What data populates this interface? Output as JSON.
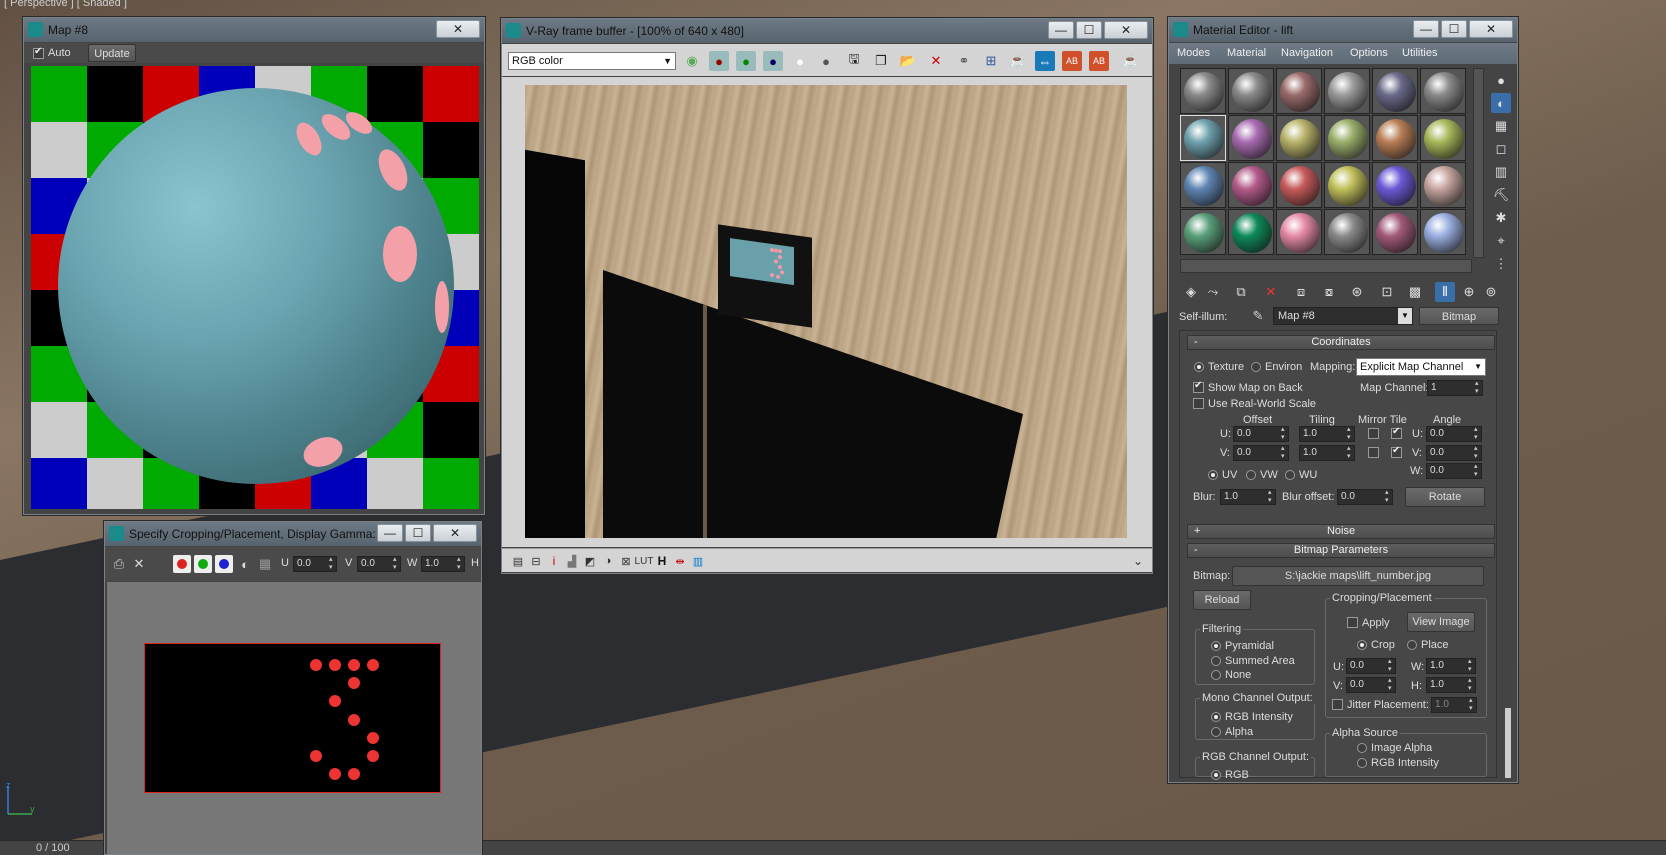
{
  "viewport": {
    "label": "[ Perspective ] [ Shaded ]"
  },
  "status_bar": {
    "progress": "0 / 100"
  },
  "map8": {
    "title": "Map #8",
    "auto_label": "Auto",
    "update_label": "Update",
    "checker_colors": [
      "#00aa00",
      "#0000bb",
      "#000000",
      "#cccccc",
      "#cc0000"
    ]
  },
  "crop": {
    "title": "Specify Cropping/Placement, Display Gamma: 2....",
    "u_label": "U",
    "u_value": "0.0",
    "v_label": "V",
    "v_value": "0.0",
    "w_label": "W",
    "w_value": "1.0",
    "h_label": "H"
  },
  "vray": {
    "title": "V-Ray frame buffer - [100% of 640 x 480]",
    "channel": "RGB color",
    "lut_label": "LUT",
    "h_label": "H"
  },
  "mat": {
    "title": "Material Editor - lift",
    "menu": [
      "Modes",
      "Material",
      "Navigation",
      "Options",
      "Utilities"
    ],
    "sphere_colors": [
      "#8a8a8a",
      "#8a8a8a",
      "#9a6a6a",
      "#9a9a9a",
      "#6a6a8a",
      "#8a8a8a",
      "#6fa2ad",
      "#a86bb0",
      "#b9b36a",
      "#9aae6a",
      "#b87e55",
      "#a7b85a",
      "#5f86b3",
      "#b45a8a",
      "#c75a5a",
      "#c0c05a",
      "#6a5ad6",
      "#c7a5a0",
      "#5aa07a",
      "#0d8a5a",
      "#e58aa5",
      "#8a8a8a",
      "#a25a7a",
      "#9aaee0"
    ],
    "selfillum_label": "Self-illum:",
    "selfillum_value": "Map #8",
    "bitmap_btn": "Bitmap",
    "coords": {
      "header": "Coordinates",
      "texture": "Texture",
      "environ": "Environ",
      "mapping_label": "Mapping:",
      "mapping_value": "Explicit Map Channel",
      "show_map": "Show Map on Back",
      "map_channel_label": "Map Channel:",
      "map_channel_value": "1",
      "real_world": "Use Real-World Scale",
      "offset": "Offset",
      "tiling": "Tiling",
      "mirror_tile": "Mirror Tile",
      "angle": "Angle",
      "u": "U:",
      "v": "V:",
      "w": "W:",
      "u_offset": "0.0",
      "v_offset": "0.0",
      "u_tiling": "1.0",
      "v_tiling": "1.0",
      "u_angle": "0.0",
      "v_angle": "0.0",
      "w_angle": "0.0",
      "uv": "UV",
      "vw": "VW",
      "wu": "WU",
      "blur_label": "Blur:",
      "blur_value": "1.0",
      "blur_offset_label": "Blur offset:",
      "blur_offset_value": "0.0",
      "rotate": "Rotate"
    },
    "noise_header": "Noise",
    "bitmap_params": {
      "header": "Bitmap Parameters",
      "bitmap_label": "Bitmap:",
      "bitmap_path": "S:\\jackie maps\\lift_number.jpg",
      "reload": "Reload",
      "crop_group": "Cropping/Placement",
      "apply": "Apply",
      "view_image": "View Image",
      "crop": "Crop",
      "place": "Place",
      "u": "U:",
      "v": "V:",
      "w": "W:",
      "h": "H:",
      "u_value": "0.0",
      "v_value": "0.0",
      "w_value": "1.0",
      "h_value": "1.0",
      "jitter": "Jitter Placement:",
      "jitter_value": "1.0",
      "filtering": "Filtering",
      "pyramidal": "Pyramidal",
      "summed": "Summed Area",
      "none": "None",
      "mono": "Mono Channel Output:",
      "rgb_intensity": "RGB Intensity",
      "alpha": "Alpha",
      "rgb_channel": "RGB Channel Output:",
      "rgb": "RGB",
      "alpha_source": "Alpha Source",
      "image_alpha": "Image Alpha",
      "alpha_rgb_intensity": "RGB Intensity"
    }
  }
}
